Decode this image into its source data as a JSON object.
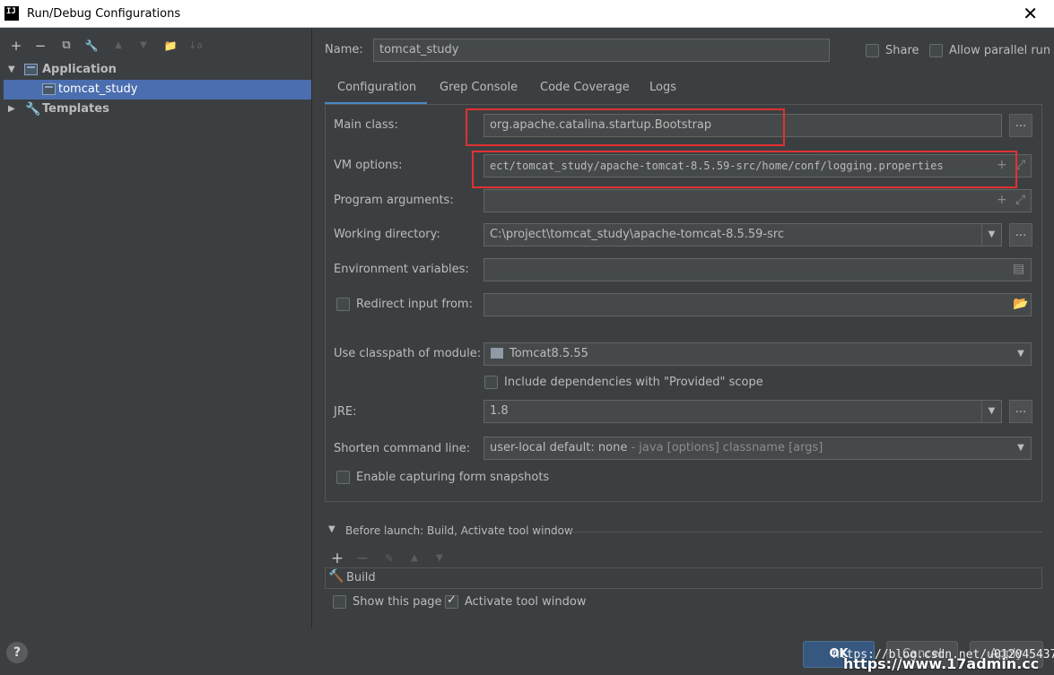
{
  "window": {
    "title": "Run/Debug Configurations",
    "app_icon": "IJ"
  },
  "left_toolbar": {
    "add": "+",
    "remove": "−",
    "copy": "⧉",
    "wrench": "🔧",
    "up": "▲",
    "down": "▼",
    "folder": "📁",
    "sort": "↓a"
  },
  "tree": {
    "application": "Application",
    "config": "tomcat_study",
    "templates": "Templates"
  },
  "header": {
    "name_label": "Name:",
    "name_value": "tomcat_study",
    "share_label": "Share",
    "parallel_label": "Allow parallel run"
  },
  "tabs": [
    "Configuration",
    "Grep Console",
    "Code Coverage",
    "Logs"
  ],
  "form": {
    "main_class_label": "Main class:",
    "main_class_value": "org.apache.catalina.startup.Bootstrap",
    "vm_options_label": "VM options:",
    "vm_options_value": "ect/tomcat_study/apache-tomcat-8.5.59-src/home/conf/logging.properties",
    "program_args_label": "Program arguments:",
    "program_args_value": "",
    "working_dir_label": "Working directory:",
    "working_dir_value": "C:\\project\\tomcat_study\\apache-tomcat-8.5.59-src",
    "env_vars_label": "Environment variables:",
    "env_vars_value": "",
    "redirect_label": "Redirect input from:",
    "redirect_value": "",
    "classpath_label": "Use classpath of module:",
    "classpath_value": "Tomcat8.5.55",
    "include_deps_label": "Include dependencies with \"Provided\" scope",
    "jre_label": "JRE:",
    "jre_value": "1.8",
    "shorten_label": "Shorten command line:",
    "shorten_value": "user-local default: none",
    "shorten_hint": " - java [options] classname [args]",
    "capture_label": "Enable capturing form snapshots",
    "dots": "..."
  },
  "before_launch": {
    "title": "Before launch: Build, Activate tool window",
    "build_item": "Build",
    "show_page_label": "Show this page",
    "activate_label": "Activate tool window"
  },
  "footer": {
    "help": "?",
    "ok": "OK",
    "cancel": "Cancel",
    "apply": "Apply",
    "watermark_url": "https://blog.csdn.net/u012045437",
    "watermark_site": "https://www.17admin.cc"
  }
}
